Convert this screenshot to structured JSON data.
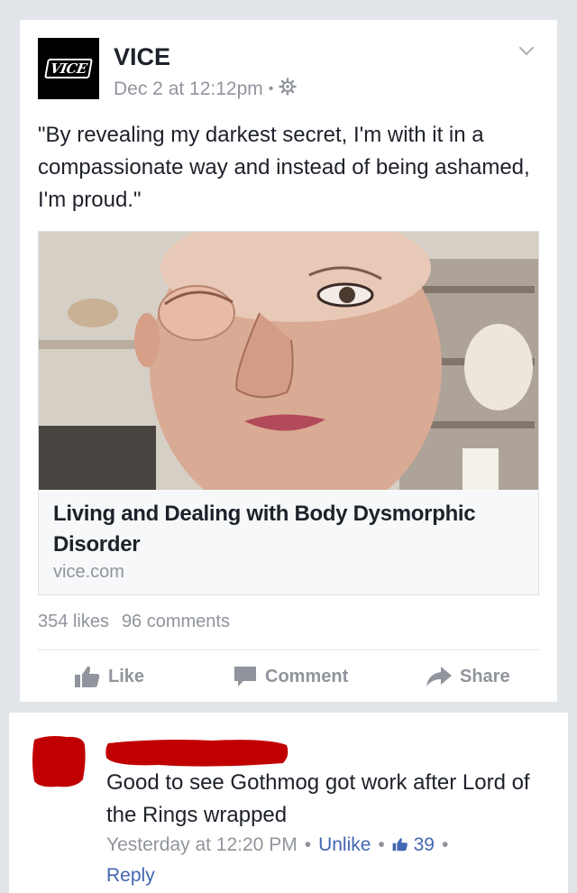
{
  "post": {
    "page_name": "VICE",
    "avatar_logo_text": "VICE",
    "timestamp": "Dec 2 at 12:12pm",
    "meta_separator": "•",
    "audience_icon": "gear-icon",
    "menu_icon": "chevron-down-icon",
    "text": "\"By revealing my darkest secret, I'm with it in a compassionate way and instead of being ashamed, I'm proud.\""
  },
  "link_preview": {
    "title": "Living and Dealing with Body Dysmorphic Disorder",
    "domain": "vice.com"
  },
  "engagement": {
    "likes": "354 likes",
    "comments": "96 comments"
  },
  "actions": {
    "like": "Like",
    "comment": "Comment",
    "share": "Share"
  },
  "comment": {
    "text": "Good to see Gothmog got work after Lord of the Rings wrapped",
    "time": "Yesterday at 12:20 PM",
    "sep": "•",
    "unlike": "Unlike",
    "like_count": "39",
    "reply": "Reply"
  },
  "colors": {
    "accent": "#4267b2",
    "muted": "#90949c",
    "redaction": "#c00000"
  }
}
